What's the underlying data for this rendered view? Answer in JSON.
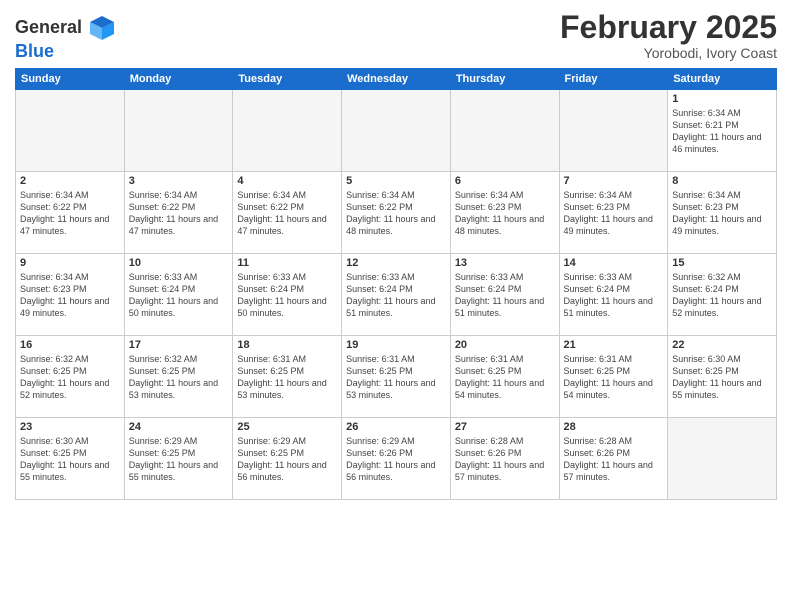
{
  "header": {
    "logo_general": "General",
    "logo_blue": "Blue",
    "month": "February 2025",
    "location": "Yorobodi, Ivory Coast"
  },
  "weekdays": [
    "Sunday",
    "Monday",
    "Tuesday",
    "Wednesday",
    "Thursday",
    "Friday",
    "Saturday"
  ],
  "weeks": [
    [
      {
        "day": "",
        "detail": ""
      },
      {
        "day": "",
        "detail": ""
      },
      {
        "day": "",
        "detail": ""
      },
      {
        "day": "",
        "detail": ""
      },
      {
        "day": "",
        "detail": ""
      },
      {
        "day": "",
        "detail": ""
      },
      {
        "day": "1",
        "detail": "Sunrise: 6:34 AM\nSunset: 6:21 PM\nDaylight: 11 hours\nand 46 minutes."
      }
    ],
    [
      {
        "day": "2",
        "detail": "Sunrise: 6:34 AM\nSunset: 6:22 PM\nDaylight: 11 hours\nand 47 minutes."
      },
      {
        "day": "3",
        "detail": "Sunrise: 6:34 AM\nSunset: 6:22 PM\nDaylight: 11 hours\nand 47 minutes."
      },
      {
        "day": "4",
        "detail": "Sunrise: 6:34 AM\nSunset: 6:22 PM\nDaylight: 11 hours\nand 47 minutes."
      },
      {
        "day": "5",
        "detail": "Sunrise: 6:34 AM\nSunset: 6:22 PM\nDaylight: 11 hours\nand 48 minutes."
      },
      {
        "day": "6",
        "detail": "Sunrise: 6:34 AM\nSunset: 6:23 PM\nDaylight: 11 hours\nand 48 minutes."
      },
      {
        "day": "7",
        "detail": "Sunrise: 6:34 AM\nSunset: 6:23 PM\nDaylight: 11 hours\nand 49 minutes."
      },
      {
        "day": "8",
        "detail": "Sunrise: 6:34 AM\nSunset: 6:23 PM\nDaylight: 11 hours\nand 49 minutes."
      }
    ],
    [
      {
        "day": "9",
        "detail": "Sunrise: 6:34 AM\nSunset: 6:23 PM\nDaylight: 11 hours\nand 49 minutes."
      },
      {
        "day": "10",
        "detail": "Sunrise: 6:33 AM\nSunset: 6:24 PM\nDaylight: 11 hours\nand 50 minutes."
      },
      {
        "day": "11",
        "detail": "Sunrise: 6:33 AM\nSunset: 6:24 PM\nDaylight: 11 hours\nand 50 minutes."
      },
      {
        "day": "12",
        "detail": "Sunrise: 6:33 AM\nSunset: 6:24 PM\nDaylight: 11 hours\nand 51 minutes."
      },
      {
        "day": "13",
        "detail": "Sunrise: 6:33 AM\nSunset: 6:24 PM\nDaylight: 11 hours\nand 51 minutes."
      },
      {
        "day": "14",
        "detail": "Sunrise: 6:33 AM\nSunset: 6:24 PM\nDaylight: 11 hours\nand 51 minutes."
      },
      {
        "day": "15",
        "detail": "Sunrise: 6:32 AM\nSunset: 6:24 PM\nDaylight: 11 hours\nand 52 minutes."
      }
    ],
    [
      {
        "day": "16",
        "detail": "Sunrise: 6:32 AM\nSunset: 6:25 PM\nDaylight: 11 hours\nand 52 minutes."
      },
      {
        "day": "17",
        "detail": "Sunrise: 6:32 AM\nSunset: 6:25 PM\nDaylight: 11 hours\nand 53 minutes."
      },
      {
        "day": "18",
        "detail": "Sunrise: 6:31 AM\nSunset: 6:25 PM\nDaylight: 11 hours\nand 53 minutes."
      },
      {
        "day": "19",
        "detail": "Sunrise: 6:31 AM\nSunset: 6:25 PM\nDaylight: 11 hours\nand 53 minutes."
      },
      {
        "day": "20",
        "detail": "Sunrise: 6:31 AM\nSunset: 6:25 PM\nDaylight: 11 hours\nand 54 minutes."
      },
      {
        "day": "21",
        "detail": "Sunrise: 6:31 AM\nSunset: 6:25 PM\nDaylight: 11 hours\nand 54 minutes."
      },
      {
        "day": "22",
        "detail": "Sunrise: 6:30 AM\nSunset: 6:25 PM\nDaylight: 11 hours\nand 55 minutes."
      }
    ],
    [
      {
        "day": "23",
        "detail": "Sunrise: 6:30 AM\nSunset: 6:25 PM\nDaylight: 11 hours\nand 55 minutes."
      },
      {
        "day": "24",
        "detail": "Sunrise: 6:29 AM\nSunset: 6:25 PM\nDaylight: 11 hours\nand 55 minutes."
      },
      {
        "day": "25",
        "detail": "Sunrise: 6:29 AM\nSunset: 6:25 PM\nDaylight: 11 hours\nand 56 minutes."
      },
      {
        "day": "26",
        "detail": "Sunrise: 6:29 AM\nSunset: 6:26 PM\nDaylight: 11 hours\nand 56 minutes."
      },
      {
        "day": "27",
        "detail": "Sunrise: 6:28 AM\nSunset: 6:26 PM\nDaylight: 11 hours\nand 57 minutes."
      },
      {
        "day": "28",
        "detail": "Sunrise: 6:28 AM\nSunset: 6:26 PM\nDaylight: 11 hours\nand 57 minutes."
      },
      {
        "day": "",
        "detail": ""
      }
    ]
  ]
}
